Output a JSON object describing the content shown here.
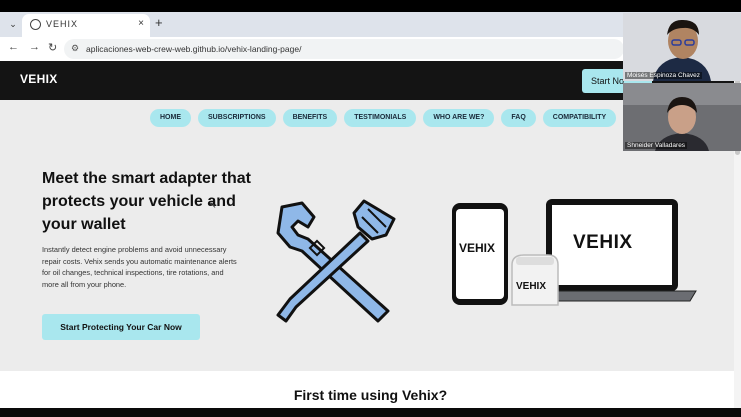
{
  "browser": {
    "tab_title": "VEHIX",
    "tab_close": "×",
    "new_tab": "+",
    "tab_menu": "⌄",
    "nav": {
      "back": "←",
      "forward": "→",
      "reload": "↻"
    },
    "url": "aplicaciones-web-crew-web.github.io/vehix-landing-page/"
  },
  "site": {
    "logo": "VEHIX",
    "header_cta": "Start No",
    "nav_items": [
      "HOME",
      "SUBSCRIPTIONS",
      "BENEFITS",
      "TESTIMONIALS",
      "WHO ARE WE?",
      "FAQ",
      "COMPATIBILITY"
    ],
    "hero": {
      "title": "Meet the smart adapter that protects your vehicle and your wallet",
      "description": "Instantly detect engine problems and avoid unnecessary repair costs. Vehix sends you automatic maintenance alerts for oil changes, technical inspections, tire rotations, and more all from your phone.",
      "cta": "Start Protecting Your Car Now"
    },
    "device_labels": {
      "phone": "VEHIX",
      "adapter": "VEHIX",
      "laptop": "VEHIX"
    },
    "section2_title": "First time using Vehix?"
  },
  "video_call": {
    "participants": [
      {
        "name": "Moisés Espinoza Chavez"
      },
      {
        "name": "Shneider Valladares"
      }
    ]
  },
  "colors": {
    "accent": "#a9e7ee",
    "header_bg": "#141414",
    "page_bg": "#ececec",
    "tool_fill": "#8fb8e8"
  }
}
